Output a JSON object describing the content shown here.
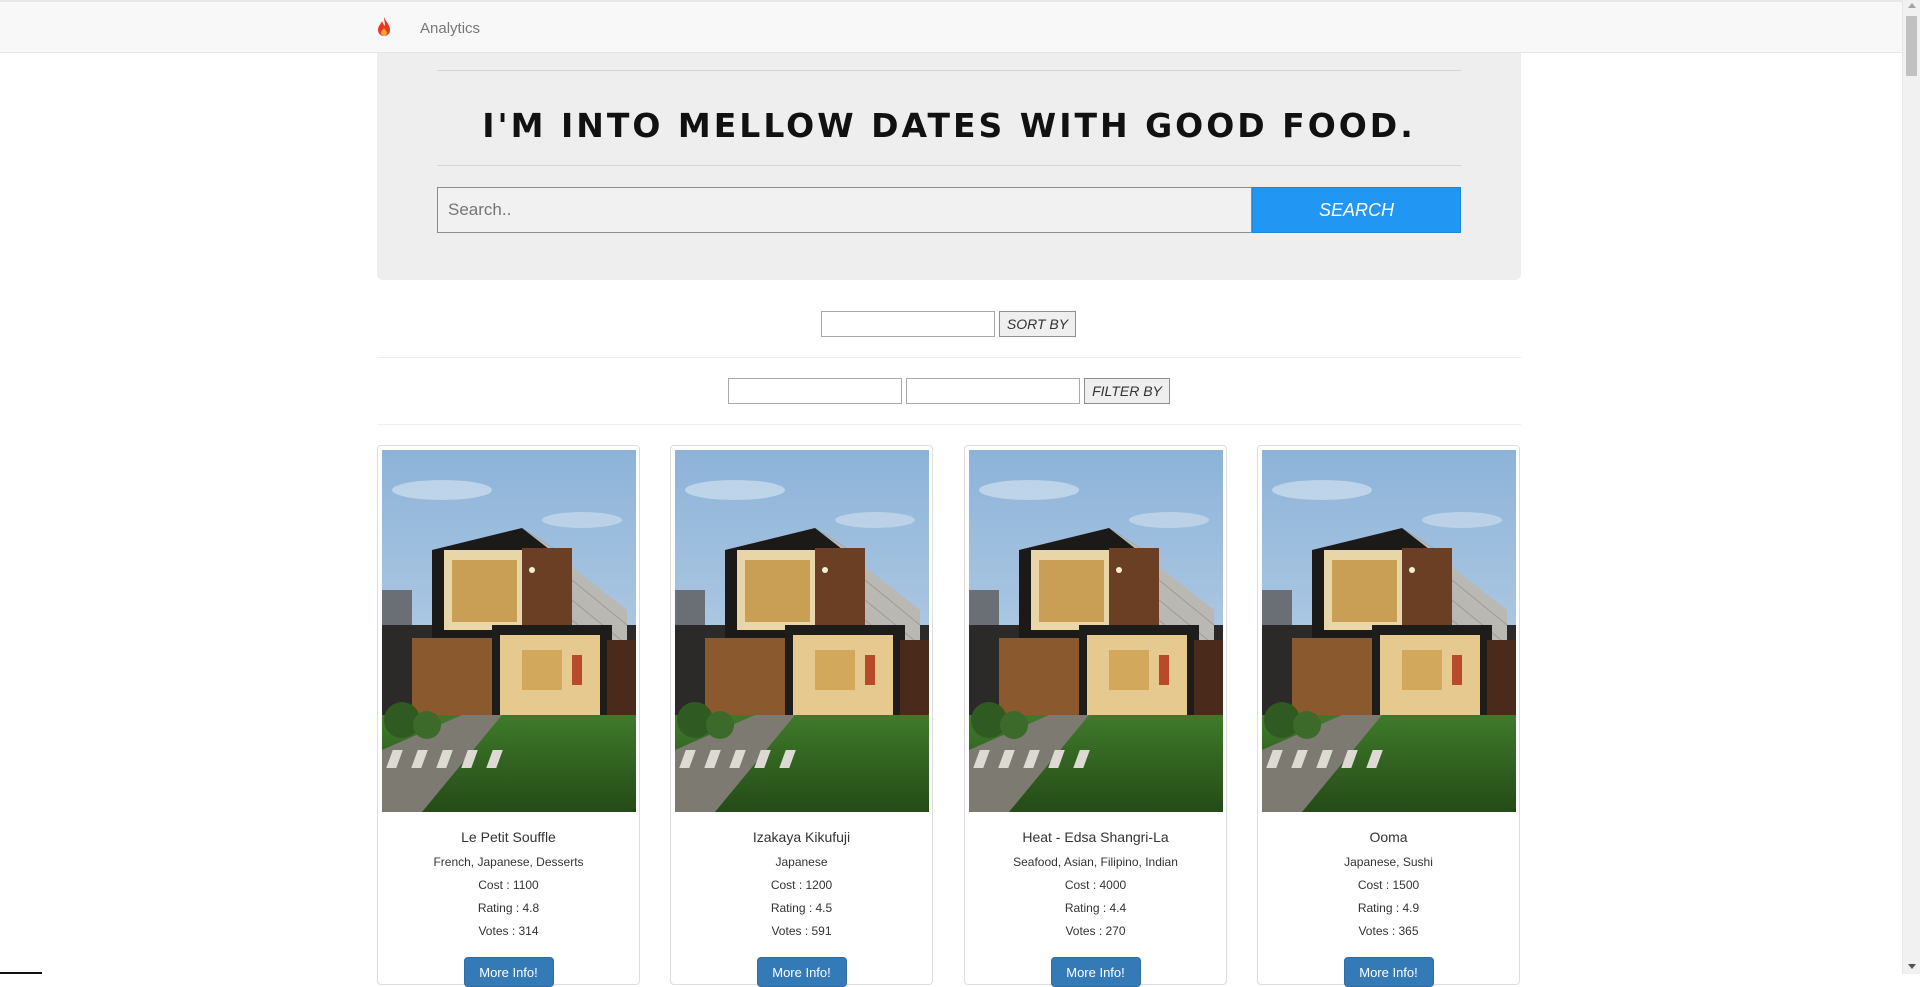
{
  "navbar": {
    "brand_icon": "flame-icon",
    "brand_color": "#e8381e",
    "link": "Analytics"
  },
  "hero": {
    "headline": "I'M INTO MELLOW DATES WITH GOOD FOOD.",
    "search": {
      "placeholder": "Search..",
      "value": "",
      "button": "SEARCH"
    },
    "accent_color": "#2196F3"
  },
  "sort": {
    "button": "SORT BY",
    "value": ""
  },
  "filter": {
    "button": "FILTER BY",
    "value_1": "",
    "value_2": ""
  },
  "cards": [
    {
      "name": "Le Petit Souffle",
      "cuisine": "French, Japanese, Desserts",
      "cost": "Cost : 1100",
      "rating": "Rating : 4.8",
      "votes": "Votes : 314",
      "button": "More Info!"
    },
    {
      "name": "Izakaya Kikufuji",
      "cuisine": "Japanese",
      "cost": "Cost : 1200",
      "rating": "Rating : 4.5",
      "votes": "Votes : 591",
      "button": "More Info!"
    },
    {
      "name": "Heat - Edsa Shangri-La",
      "cuisine": "Seafood, Asian, Filipino, Indian",
      "cost": "Cost : 4000",
      "rating": "Rating : 4.4",
      "votes": "Votes : 270",
      "button": "More Info!"
    },
    {
      "name": "Ooma",
      "cuisine": "Japanese, Sushi",
      "cost": "Cost : 1500",
      "rating": "Rating : 4.9",
      "votes": "Votes : 365",
      "button": "More Info!"
    }
  ]
}
